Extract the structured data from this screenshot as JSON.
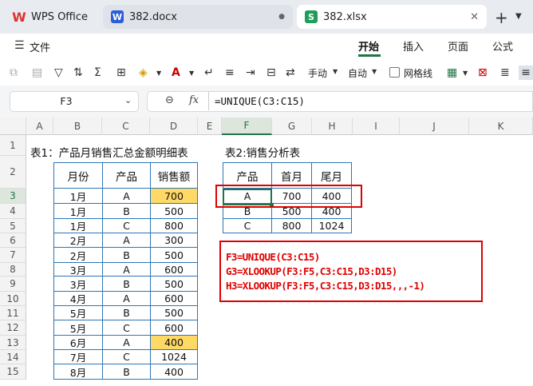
{
  "tabs": [
    {
      "label": "WPS Office",
      "icon": "wps-logo-icon"
    },
    {
      "label": "382.docx",
      "icon": "W"
    },
    {
      "label": "382.xlsx",
      "icon": "S"
    }
  ],
  "menu": {
    "file": "文件",
    "items": [
      "开始",
      "插入",
      "页面",
      "公式"
    ]
  },
  "toolbar": {
    "wrap": "手动",
    "auto": "自动",
    "gridlines": "网格线"
  },
  "formula": {
    "namebox": "F3",
    "fx": "fx",
    "content": "=UNIQUE(C3:C15)"
  },
  "columns": [
    "A",
    "B",
    "C",
    "D",
    "E",
    "F",
    "G",
    "H",
    "I",
    "J",
    "K"
  ],
  "rows": [
    "1",
    "2",
    "3",
    "4",
    "5",
    "6",
    "7",
    "8",
    "9",
    "10",
    "11",
    "12",
    "13",
    "14",
    "15"
  ],
  "title1": "表1：产品月销售汇总金额明细表",
  "title2": "表2:销售分析表",
  "table1": {
    "headers": [
      "月份",
      "产品",
      "销售额"
    ],
    "rows": [
      [
        "1月",
        "A",
        "700"
      ],
      [
        "1月",
        "B",
        "500"
      ],
      [
        "1月",
        "C",
        "800"
      ],
      [
        "2月",
        "A",
        "300"
      ],
      [
        "2月",
        "B",
        "500"
      ],
      [
        "3月",
        "A",
        "600"
      ],
      [
        "3月",
        "B",
        "500"
      ],
      [
        "4月",
        "A",
        "600"
      ],
      [
        "5月",
        "B",
        "500"
      ],
      [
        "5月",
        "C",
        "600"
      ],
      [
        "6月",
        "A",
        "400"
      ],
      [
        "7月",
        "C",
        "1024"
      ],
      [
        "8月",
        "B",
        "400"
      ]
    ]
  },
  "table2": {
    "headers": [
      "产品",
      "首月",
      "尾月"
    ],
    "rows": [
      [
        "A",
        "700",
        "400"
      ],
      [
        "B",
        "500",
        "400"
      ],
      [
        "C",
        "800",
        "1024"
      ]
    ]
  },
  "notes": [
    "F3=UNIQUE(C3:C15)",
    "G3=XLOOKUP(F3:F5,C3:C15,D3:D15)",
    "H3=XLOOKUP(F3:F5,C3:C15,D3:D15,,,-1)"
  ],
  "colors": {
    "highlight": "#ffd966",
    "accent": "#2e75b6",
    "red": "#e00000",
    "green": "#217346"
  }
}
